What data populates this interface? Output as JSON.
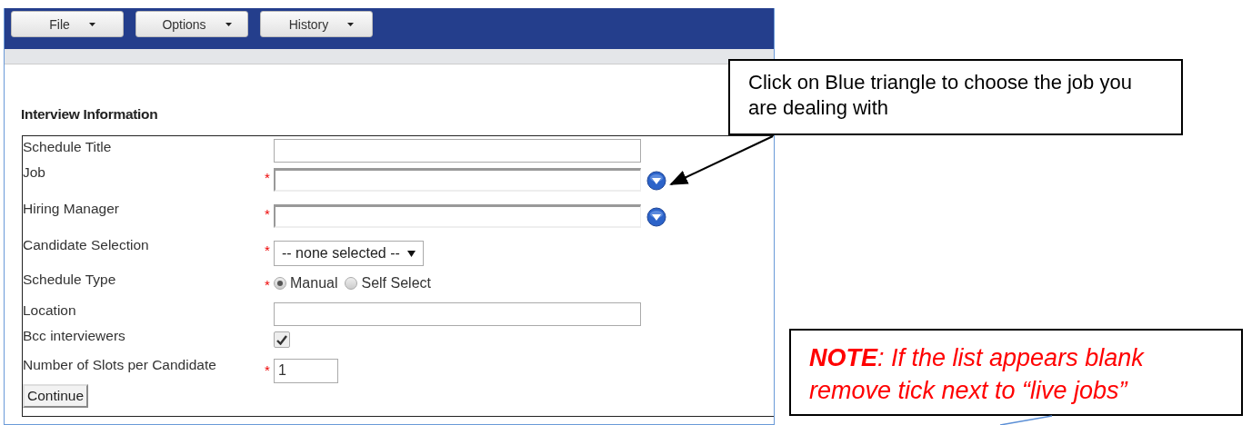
{
  "menus": [
    {
      "label": "File"
    },
    {
      "label": "Options"
    },
    {
      "label": "History"
    }
  ],
  "section_title": "Interview Information",
  "fields": [
    {
      "label": "Schedule Title",
      "kind": "text"
    },
    {
      "label": "Job",
      "required_mark": "*",
      "kind": "lookup"
    },
    {
      "label": "Hiring Manager",
      "required_mark": "*",
      "kind": "lookup"
    },
    {
      "label": "Candidate Selection",
      "required_mark": "*",
      "kind": "select",
      "value": "-- none selected --"
    },
    {
      "label": "Schedule Type",
      "required_mark": "*",
      "kind": "radio",
      "options": [
        {
          "label": "Manual",
          "selected": true
        },
        {
          "label": "Self Select",
          "selected": false
        }
      ]
    },
    {
      "label": "Location",
      "kind": "text"
    },
    {
      "label": "Bcc interviewers",
      "kind": "checkbox",
      "checked": true
    },
    {
      "label": "Number of Slots per Candidate",
      "required_mark": "*",
      "kind": "short",
      "value": "1"
    }
  ],
  "continue_button": "Continue",
  "callouts": [
    {
      "kind": "plain",
      "text": "Click on Blue triangle to choose the job you are dealing with"
    },
    {
      "kind": "note",
      "text": "**NOTE**: If the list appears blank remove tick next to “live jobs”"
    }
  ]
}
